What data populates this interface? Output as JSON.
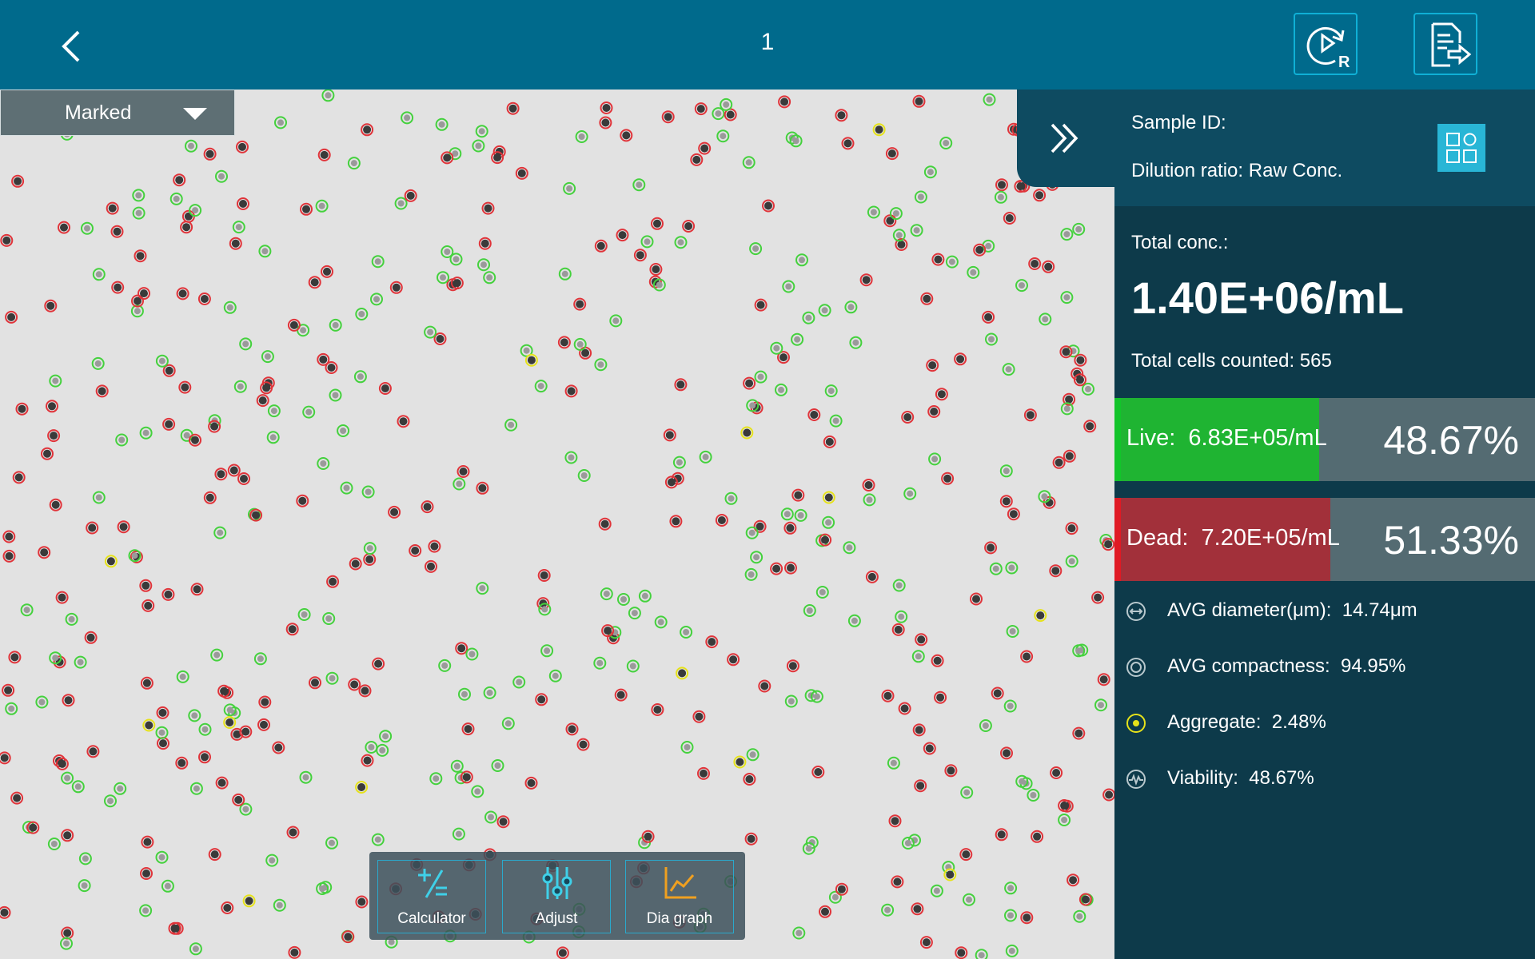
{
  "header": {
    "title": "1"
  },
  "image_view": {
    "display_mode": "Marked"
  },
  "panel": {
    "sample_id_label": "Sample ID:",
    "dilution_label": "Dilution ratio:",
    "dilution_value": "Raw Conc.",
    "total_conc_label": "Total conc.:",
    "total_conc_value": "1.40E+06/mL",
    "total_cells_label": "Total cells counted:",
    "total_cells_value": "565",
    "live": {
      "label": "Live:",
      "value": "6.83E+05/mL",
      "percent": "48.67%",
      "fraction": 0.4867,
      "color": "#1fb432"
    },
    "dead": {
      "label": "Dead:",
      "value": "7.20E+05/mL",
      "percent": "51.33%",
      "fraction": 0.5133,
      "color": "#a2303a"
    },
    "metrics": [
      {
        "label": "AVG diameter(μm):",
        "value": "14.74μm",
        "icon": "diameter-icon"
      },
      {
        "label": "AVG compactness:",
        "value": "94.95%",
        "icon": "compactness-icon"
      },
      {
        "label": "Aggregate:",
        "value": "2.48%",
        "icon": "aggregate-icon"
      },
      {
        "label": "Viability:",
        "value": "48.67%",
        "icon": "viability-icon"
      }
    ]
  },
  "toolbar": {
    "calculator_label": "Calculator",
    "adjust_label": "Adjust",
    "dia_graph_label": "Dia graph"
  },
  "colors": {
    "header": "#006a8c",
    "panel": "#0d3a4a",
    "accent": "#29b6d6",
    "live_marker": "#44d13d",
    "dead_marker": "#e0343a",
    "aggregate_marker": "#e6e21a"
  }
}
